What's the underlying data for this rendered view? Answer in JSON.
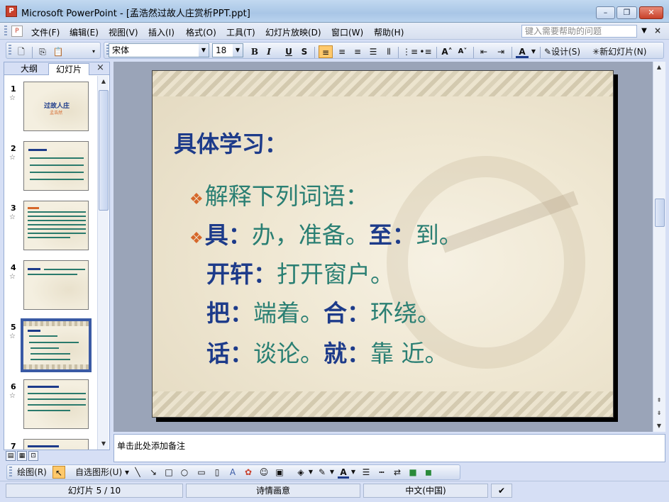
{
  "window": {
    "title": "Microsoft PowerPoint - [孟浩然过故人庄赏析PPT.ppt]",
    "minimize": "–",
    "maximize": "❐",
    "close": "✕"
  },
  "menu": {
    "items": [
      "文件(F)",
      "编辑(E)",
      "视图(V)",
      "插入(I)",
      "格式(O)",
      "工具(T)",
      "幻灯片放映(D)",
      "窗口(W)",
      "帮助(H)"
    ],
    "help_placeholder": "键入需要帮助的问题",
    "close_label": "×"
  },
  "toolbar": {
    "font_name": "宋体",
    "font_size": "18",
    "bold": "B",
    "italic": "I",
    "underline": "U",
    "shadow": "S",
    "design_label": "设计(S)",
    "new_slide_label": "新幻灯片(N)"
  },
  "left_panel": {
    "tab_outline": "大纲",
    "tab_slides": "幻灯片",
    "close": "×",
    "slides": [
      {
        "num": "1",
        "title": "过故人庄",
        "subtitle": "孟浩然"
      },
      {
        "num": "2"
      },
      {
        "num": "3"
      },
      {
        "num": "4"
      },
      {
        "num": "5",
        "selected": true
      },
      {
        "num": "6"
      },
      {
        "num": "7"
      }
    ]
  },
  "slide": {
    "title": "具体学习：",
    "line1": "解释下列词语：",
    "line2": [
      {
        "t": "具：",
        "kw": true
      },
      {
        "t": "办，准备。",
        "kw": false
      },
      {
        "t": "至：",
        "kw": true
      },
      {
        "t": "到。",
        "kw": false
      }
    ],
    "line3": [
      {
        "t": "开轩：",
        "kw": true
      },
      {
        "t": "打开窗户。",
        "kw": false
      }
    ],
    "line4": [
      {
        "t": "把：",
        "kw": true
      },
      {
        "t": "端着。",
        "kw": false
      },
      {
        "t": "合：",
        "kw": true
      },
      {
        "t": "环绕。",
        "kw": false
      }
    ],
    "line5": [
      {
        "t": "话：",
        "kw": true
      },
      {
        "t": "谈论。",
        "kw": false
      },
      {
        "t": "就：",
        "kw": true
      },
      {
        "t": "靠 近。",
        "kw": false
      }
    ]
  },
  "notes": {
    "placeholder": "单击此处添加备注"
  },
  "drawing_toolbar": {
    "draw_label": "绘图(R)",
    "autoshapes_label": "自选图形(U)"
  },
  "status": {
    "slide_info": "幻灯片 5 / 10",
    "design_name": "诗情画意",
    "language": "中文(中国)"
  },
  "colors": {
    "title_blue": "#1d3b8a",
    "body_teal": "#2a7f73",
    "bullet_orange": "#d6672a"
  }
}
